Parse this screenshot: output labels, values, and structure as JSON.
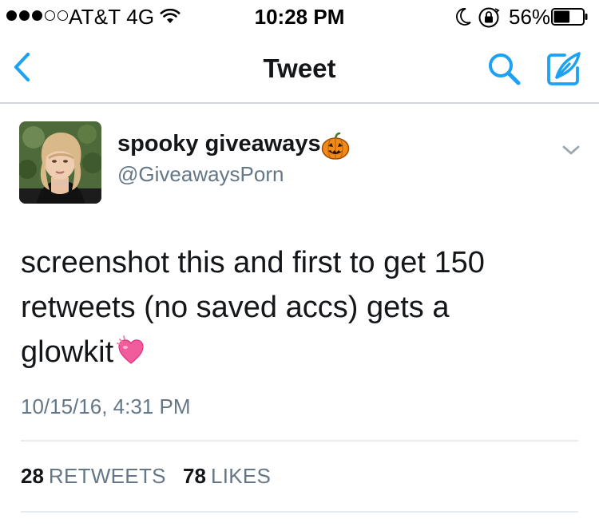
{
  "status_bar": {
    "carrier": "AT&T 4G",
    "time": "10:28 PM",
    "battery": "56%",
    "battery_level": 0.56,
    "signal_bars_filled": 3,
    "signal_bars_total": 5,
    "icons": [
      "signal-dots",
      "wifi-icon",
      "moon-icon",
      "orientation-lock-icon",
      "battery-icon"
    ]
  },
  "nav": {
    "title": "Tweet",
    "accent_color": "#1da1f2",
    "icons": [
      "back-chevron-icon",
      "search-icon",
      "compose-icon"
    ]
  },
  "tweet": {
    "display_name": "spooky giveaways",
    "name_emoji": "jack-o-lantern",
    "handle": "@GiveawaysPorn",
    "text_lines": [
      "screenshot this and first to get 150",
      "retweets (no saved accs) gets a",
      "glowkit"
    ],
    "text_emoji": "sparkling-heart",
    "timestamp": "10/15/16, 4:31 PM",
    "retweets_count": "28",
    "retweets_label": "RETWEETS",
    "likes_count": "78",
    "likes_label": "LIKES"
  }
}
